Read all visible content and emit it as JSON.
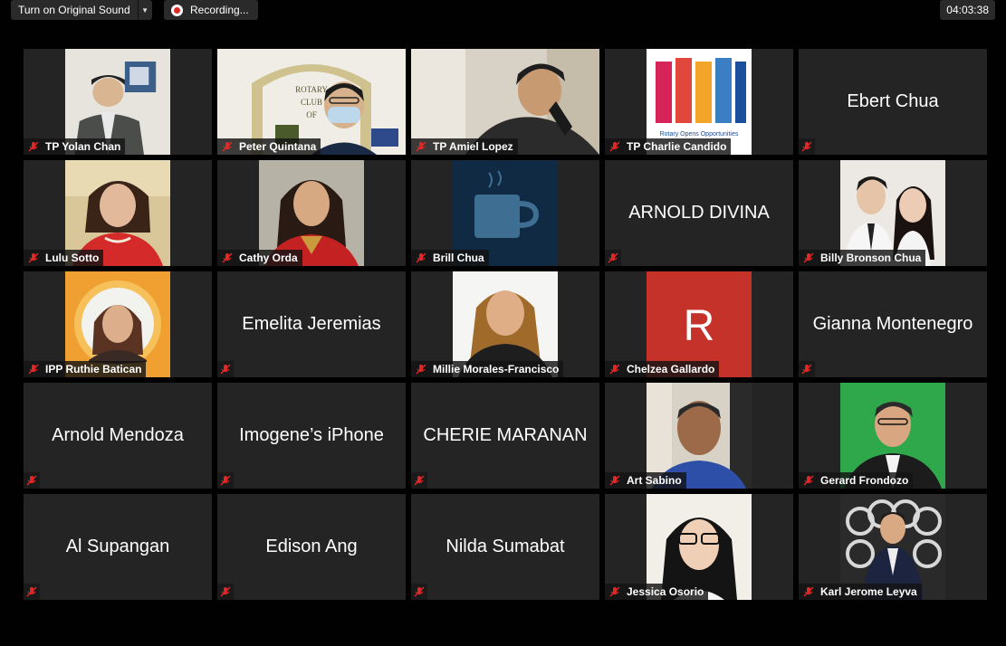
{
  "toolbar": {
    "original_sound_label": "Turn on Original Sound",
    "recording_label": "Recording...",
    "timer": "04:03:38"
  },
  "participants": [
    {
      "name": "TP Yolan Chan",
      "display": "video"
    },
    {
      "name": "Peter Quintana",
      "display": "video"
    },
    {
      "name": "TP Amiel Lopez",
      "display": "video"
    },
    {
      "name": "TP Charlie Candido",
      "display": "image",
      "image_caption": "Rotary Opens Opportunities"
    },
    {
      "name": "Ebert Chua",
      "display": "name"
    },
    {
      "name": "Lulu Sotto",
      "display": "video"
    },
    {
      "name": "Cathy Orda",
      "display": "video"
    },
    {
      "name": "Brill Chua",
      "display": "image",
      "image_caption": "coffee-cup-icon"
    },
    {
      "name": "ARNOLD DIVINA",
      "display": "name"
    },
    {
      "name": "Billy Bronson Chua",
      "display": "video"
    },
    {
      "name": "IPP Ruthie Batican",
      "display": "video"
    },
    {
      "name": "Emelita Jeremias",
      "display": "name"
    },
    {
      "name": "Millie Morales-Francisco",
      "display": "video"
    },
    {
      "name": "Chelzea Gallardo",
      "display": "avatar",
      "avatar_letter": "R"
    },
    {
      "name": "Gianna Montenegro",
      "display": "name"
    },
    {
      "name": "Arnold Mendoza",
      "display": "name"
    },
    {
      "name": "Imogene’s iPhone",
      "display": "name"
    },
    {
      "name": "CHERIE MARANAN",
      "display": "name"
    },
    {
      "name": "Art Sabino",
      "display": "video"
    },
    {
      "name": "Gerard Frondozo",
      "display": "video"
    },
    {
      "name": "Al Supangan",
      "display": "name"
    },
    {
      "name": "Edison Ang",
      "display": "name"
    },
    {
      "name": "Nilda Sumabat",
      "display": "name"
    },
    {
      "name": "Jessica Osorio",
      "display": "video"
    },
    {
      "name": "Karl Jerome Leyva",
      "display": "video"
    }
  ],
  "rotary_sign": {
    "line1": "ROTARY",
    "line2": "CLUB",
    "line3": "OF"
  },
  "colors": {
    "tile_bg": "#242424",
    "mic_muted": "#e02828",
    "avatar_bg": "#c4322a"
  }
}
